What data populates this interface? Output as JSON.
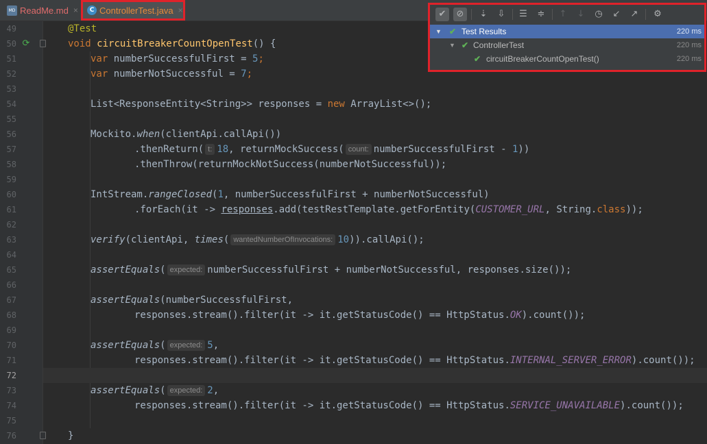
{
  "tabs": [
    {
      "label": "ReadMe.md",
      "icon": "markdown-file-icon",
      "close": "×"
    },
    {
      "label": "ControllerTest.java",
      "icon": "java-class-icon",
      "close": "×"
    }
  ],
  "test_results": {
    "toolbar": [
      "check-icon",
      "cancel-icon",
      "sort-alpha-icon",
      "sort-duration-icon",
      "expand-all-icon",
      "collapse-all-icon",
      "previous-icon",
      "next-icon",
      "history-icon",
      "import-icon",
      "export-icon",
      "settings-icon"
    ],
    "rows": [
      {
        "label": "Test Results",
        "time": "220 ms"
      },
      {
        "label": "ControllerTest",
        "time": "220 ms"
      },
      {
        "label": "circuitBreakerCountOpenTest()",
        "time": "220 ms"
      }
    ]
  },
  "line_numbers": [
    "49",
    "50",
    "51",
    "52",
    "53",
    "54",
    "55",
    "56",
    "57",
    "58",
    "59",
    "60",
    "61",
    "62",
    "63",
    "64",
    "65",
    "66",
    "67",
    "68",
    "69",
    "70",
    "71",
    "72",
    "73",
    "74",
    "75",
    "76"
  ],
  "hints": {
    "t": "t:",
    "count": "count:",
    "wanted": "wantedNumberOfInvocations:",
    "expected": "expected:"
  },
  "code": {
    "l49_ann": "@Test",
    "l50_kw": "void",
    "l50_fn": "circuitBreakerCountOpenTest",
    "l50_rest": "() {",
    "l51_kw": "var",
    "l51_a": " numberSuccessfulFirst = ",
    "l51_n": "5",
    "l51_b": ";",
    "l52_kw": "var",
    "l52_a": " numberNotSuccessful = ",
    "l52_n": "7",
    "l52_b": ";",
    "l54_a": "List<ResponseEntity<String>> responses = ",
    "l54_kw": "new",
    "l54_b": " ArrayList<>();",
    "l56_a": "Mockito.",
    "l56_it": "when",
    "l56_b": "(clientApi.callApi())",
    "l57_a": ".thenReturn(",
    "l57_n": "18",
    "l57_b": ", returnMockSuccess(",
    "l57_c": "numberSuccessfulFirst - ",
    "l57_n2": "1",
    "l57_d": "))",
    "l58_a": ".thenThrow(returnMockNotSuccess(numberNotSuccessful));",
    "l60_a": "IntStream.",
    "l60_it": "rangeClosed",
    "l60_b": "(",
    "l60_n": "1",
    "l60_c": ", numberSuccessfulFirst + numberNotSuccessful)",
    "l61_a": ".forEach(it -> ",
    "l61_u": "responses",
    "l61_b": ".add(testRestTemplate.getForEntity(",
    "l61_f": "CUSTOMER_URL",
    "l61_c": ", String.",
    "l61_kw": "class",
    "l61_d": "));",
    "l63_it": "verify",
    "l63_a": "(clientApi, ",
    "l63_it2": "times",
    "l63_b": "(",
    "l63_n": "10",
    "l63_c": ")).callApi();",
    "l65_it": "assertEquals",
    "l65_a": "(",
    "l65_b": "numberSuccessfulFirst + numberNotSuccessful, responses.size());",
    "l67_it": "assertEquals",
    "l67_a": "(numberSuccessfulFirst,",
    "l68_a": "responses.stream().filter(it -> it.getStatusCode() == HttpStatus.",
    "l68_f": "OK",
    "l68_b": ").count());",
    "l70_it": "assertEquals",
    "l70_a": "(",
    "l70_n": "5",
    "l70_b": ",",
    "l71_a": "responses.stream().filter(it -> it.getStatusCode() == HttpStatus.",
    "l71_f": "INTERNAL_SERVER_ERROR",
    "l71_b": ").count());",
    "l73_it": "assertEquals",
    "l73_a": "(",
    "l73_n": "2",
    "l73_b": ",",
    "l74_a": "responses.stream().filter(it -> it.getStatusCode() == HttpStatus.",
    "l74_f": "SERVICE_UNAVAILABLE",
    "l74_b": ").count());",
    "l76_a": "}"
  },
  "colors": {
    "editor_bg": "#2b2b2b",
    "keyword": "#cc7832",
    "annotation": "#bbb529",
    "function": "#ffc66d",
    "number": "#6897bb",
    "field": "#9876aa",
    "pass": "#5fb157",
    "selection": "#4b6eaf",
    "highlight_border": "#e0222a"
  }
}
